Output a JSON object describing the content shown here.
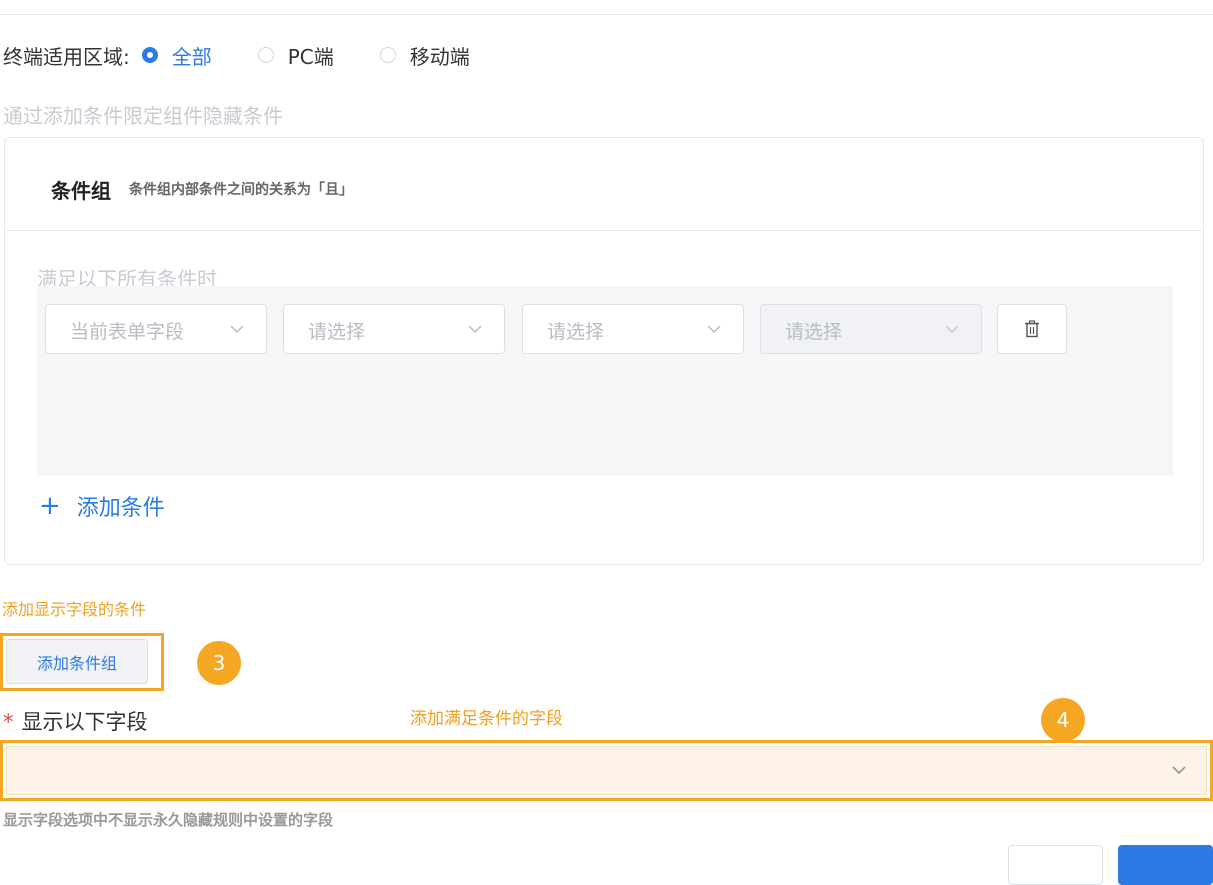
{
  "terminal": {
    "label": "终端适用区域:",
    "options": [
      {
        "label": "全部",
        "checked": true
      },
      {
        "label": "PC端",
        "checked": false
      },
      {
        "label": "移动端",
        "checked": false
      }
    ]
  },
  "hint": "通过添加条件限定组件隐藏条件",
  "condition_group": {
    "title": "条件组",
    "description": "条件组内部条件之间的关系为「且」",
    "match_label": "满足以下所有条件时",
    "selects": [
      {
        "placeholder": "当前表单字段",
        "disabled": false
      },
      {
        "placeholder": "请选择",
        "disabled": false
      },
      {
        "placeholder": "请选择",
        "disabled": false
      },
      {
        "placeholder": "请选择",
        "disabled": true
      }
    ],
    "add_condition_label": "添加条件"
  },
  "annotations": {
    "add_display_condition": "添加显示字段的条件",
    "badge3": "3",
    "add_matching_fields": "添加满足条件的字段",
    "badge4": "4"
  },
  "add_group_label": "添加条件组",
  "display_fields": {
    "required_mark": "*",
    "label": "显示以下字段",
    "note": "显示字段选项中不显示永久隐藏规则中设置的字段"
  },
  "colors": {
    "accent": "#2c7be5",
    "annotation": "#f5a623",
    "required": "#e64545"
  }
}
